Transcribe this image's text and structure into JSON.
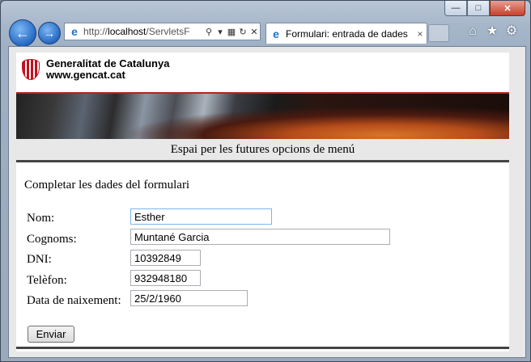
{
  "browser": {
    "address_prefix": "http://",
    "address_host": "localhost",
    "address_rest": "/ServletsF",
    "tab_title": "Formulari: entrada de dades",
    "tab_close": "×",
    "icons": [
      "back-icon",
      "forward-icon",
      "ie-icon",
      "search-icon",
      "compat-icon",
      "refresh-icon",
      "stop-icon",
      "home-icon",
      "favorites-icon",
      "tools-icon"
    ]
  },
  "header": {
    "org_name": "Generalitat de Catalunya",
    "org_url": "www.gencat.cat"
  },
  "menu": {
    "placeholder": "Espai per les futures opcions de menú"
  },
  "form": {
    "title": "Completar les dades del formulari",
    "fields": [
      {
        "label": "Nom:",
        "value": "Esther"
      },
      {
        "label": "Cognoms:",
        "value": "Muntané Garcia"
      },
      {
        "label": "DNI:",
        "value": "10392849"
      },
      {
        "label": "Telèfon:",
        "value": "932948180"
      },
      {
        "label": "Data de naixement:",
        "value": "25/2/1960"
      }
    ],
    "submit_label": "Enviar"
  },
  "colors": {
    "accent_red": "#b3261e",
    "focus_border": "#7eb4ea"
  }
}
